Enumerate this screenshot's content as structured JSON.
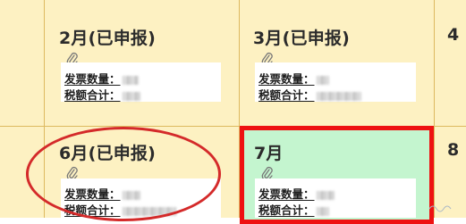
{
  "months": [
    {
      "title": "2月(已申报)",
      "invoice_label": "发票数量：",
      "tax_label": "税额合计：",
      "invoice_value": "",
      "tax_value": ""
    },
    {
      "title": "3月(已申报)",
      "invoice_label": "发票数量：",
      "tax_label": "税额合计：",
      "invoice_value": "",
      "tax_value": ""
    },
    {
      "title": "6月(已申报)",
      "invoice_label": "发票数量：",
      "tax_label": "税额合计：",
      "invoice_value": "",
      "tax_value": ""
    },
    {
      "title": "7月",
      "invoice_label": "发票数量：",
      "tax_label": "税额合计：",
      "invoice_value": "",
      "tax_value": ""
    }
  ],
  "edge_digits": [
    "4",
    "8"
  ],
  "colors": {
    "cell_bg": "#fdf1c2",
    "grid_line": "#ddb95f",
    "current_month_bg": "#c4f5cf",
    "highlight_red": "#ee1111"
  },
  "icons": [
    "paperclip-icon"
  ]
}
